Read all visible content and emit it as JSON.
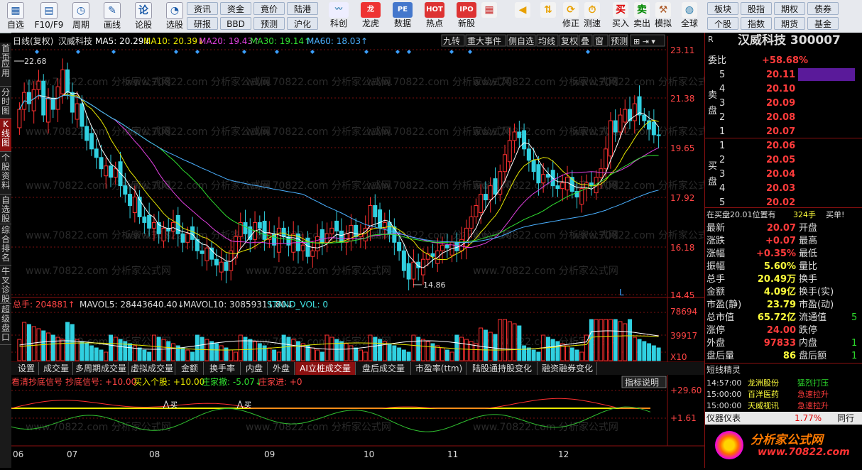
{
  "toolbar": {
    "buttons": [
      {
        "label": "自选",
        "icon": "grid-icon"
      },
      {
        "label": "F10/F9",
        "icon": "table-icon"
      },
      {
        "label": "周期",
        "icon": "clock-icon"
      },
      {
        "label": "画线",
        "icon": "pencil-icon"
      },
      {
        "label": "论股",
        "icon": "comment-icon"
      },
      {
        "label": "选股",
        "icon": "chart-circle-icon"
      }
    ],
    "menu_buttons": [
      [
        "资讯",
        "资金",
        "竟价",
        "陆港"
      ],
      [
        "研报",
        "BBD",
        "预测",
        "沪化"
      ]
    ],
    "middle_icons": [
      {
        "label": "科创",
        "icon": "chart-icon"
      },
      {
        "label": "龙虎",
        "icon": "dragon-icon"
      },
      {
        "label": "数据",
        "icon": "pe-icon"
      },
      {
        "label": "热点",
        "icon": "hot-icon"
      },
      {
        "label": "新股",
        "icon": "ipo-icon"
      }
    ],
    "right_icons": [
      {
        "label": "",
        "icon": "color-grid-icon"
      },
      {
        "label": "",
        "icon": "back-arrow-icon"
      },
      {
        "label": "",
        "icon": "up-down-arrow-icon"
      },
      {
        "label": "修正",
        "icon": "clock-refresh-icon"
      },
      {
        "label": "测速",
        "icon": "stopwatch-icon"
      },
      {
        "label": "买入",
        "icon": "buy-icon"
      },
      {
        "label": "卖出",
        "icon": "sell-icon"
      },
      {
        "label": "模拟",
        "icon": "hammer-icon"
      },
      {
        "label": "全球",
        "icon": "globe-icon"
      }
    ],
    "right_menu": [
      [
        "板块",
        "股指",
        "期权",
        "债券"
      ],
      [
        "个股",
        "指数",
        "期货",
        "基金"
      ]
    ]
  },
  "leftnav": [
    "首页",
    "应用",
    "分时图",
    "K线图",
    "个股资料",
    "自选股",
    "综合排名",
    "牛叉诊股",
    "超级盘口"
  ],
  "chart": {
    "header": {
      "title": "日线(复权)",
      "stock": "汉威科技",
      "ma5": "MA5: 20.29↓",
      "ma10": "MA10: 20.39↓",
      "ma20": "MA20: 19.43↑",
      "ma30": "MA30: 19.14↑",
      "ma60": "MA60: 18.03↑"
    },
    "header_buttons": [
      "九转",
      "重大事件",
      "侧自选",
      "均线",
      "复权",
      "叠",
      "窗",
      "预测"
    ],
    "price_axis": [
      "23.11",
      "21.38",
      "19.65",
      "17.92",
      "16.18",
      "14.45"
    ],
    "high_label": "22.68",
    "low_label": "14.86",
    "volume_header": {
      "total": "总手: 204881↑",
      "mavol5": "MAVOL5: 28443640.40↓",
      "mavol10": "MAVOL10: 30859311.80↓",
      "stand": "STAND_VOL: 0"
    },
    "volume_axis": [
      "78694",
      "39917",
      "X10"
    ],
    "tabs": [
      "设置",
      "成交量",
      "多周期成交量",
      "虚拟成交量",
      "金额",
      "换手率",
      "内盘",
      "外盘",
      "AI立桩成交量",
      "盘后成交量",
      "市盈率(ttm)",
      "陆股通持股变化",
      "融资融券变化"
    ],
    "indicator_header": {
      "name": "看清抄底信号",
      "signal": "抄底信号: +10.00",
      "buy": "买入个股: +10.00",
      "out": "庄家撤: -5.07↓",
      "in": "庄家进: +0"
    },
    "indicator_button": "指标说明",
    "indicator_axis": [
      "+29.60",
      "+1.61"
    ],
    "buy_mark": "买",
    "months": [
      "06",
      "07",
      "08",
      "09",
      "10",
      "11",
      "12"
    ],
    "watermark": "www.70822.com 分析家公式网",
    "colors": {
      "up": "#ff3030",
      "down": "#30d0e0",
      "ma5": "#ffffff",
      "ma10": "#e8e800",
      "ma20": "#e040e0",
      "ma30": "#30e030",
      "ma60": "#4ab0ff"
    }
  },
  "quote": {
    "title": "汉威科技 300007",
    "ratio_label": "委比",
    "ratio": "+58.68%",
    "sell_label": "卖盘",
    "buy_label": "买盘",
    "sells": [
      {
        "n": "5",
        "p": "20.11"
      },
      {
        "n": "4",
        "p": "20.10"
      },
      {
        "n": "3",
        "p": "20.09"
      },
      {
        "n": "2",
        "p": "20.08"
      },
      {
        "n": "1",
        "p": "20.07"
      }
    ],
    "buys": [
      {
        "n": "1",
        "p": "20.06"
      },
      {
        "n": "2",
        "p": "20.05"
      },
      {
        "n": "3",
        "p": "20.04"
      },
      {
        "n": "4",
        "p": "20.03"
      },
      {
        "n": "5",
        "p": "20.02"
      }
    ],
    "notice": "在买盘20.01位置有",
    "notice_qty": "324手",
    "notice_act": "买单!",
    "stats": [
      [
        "最新",
        "20.07",
        "开盘",
        ""
      ],
      [
        "涨跌",
        "+0.07",
        "最高",
        ""
      ],
      [
        "涨幅",
        "+0.35%",
        "最低",
        ""
      ],
      [
        "振幅",
        "5.60%",
        "量比",
        ""
      ],
      [
        "总手",
        "20.49万",
        "换手",
        ""
      ],
      [
        "金额",
        "4.09亿",
        "换手(实)",
        ""
      ],
      [
        "市盈(静)",
        "23.79",
        "市盈(动)",
        ""
      ],
      [
        "总市值",
        "65.72亿",
        "流通值",
        "5"
      ],
      [
        "涨停",
        "24.00",
        "跌停",
        ""
      ],
      [
        "外盘",
        "97833",
        "内盘",
        "1"
      ],
      [
        "盘后量",
        "86",
        "盘后额",
        "1"
      ]
    ],
    "shortline_title": "短线精灵",
    "shortline": [
      [
        "14:57:00",
        "龙洲股份",
        "猛烈打压"
      ],
      [
        "15:00:00",
        "百洋医药",
        "急速拉升"
      ],
      [
        "15:00:00",
        "天威视讯",
        "急速拉升"
      ]
    ],
    "meter_label": "仪器仪表",
    "meter_value": "1.77%",
    "meter_tab": "同行",
    "logo_text": "分析家公式网",
    "logo_url": "www.70822.com",
    "r_label": "R"
  }
}
